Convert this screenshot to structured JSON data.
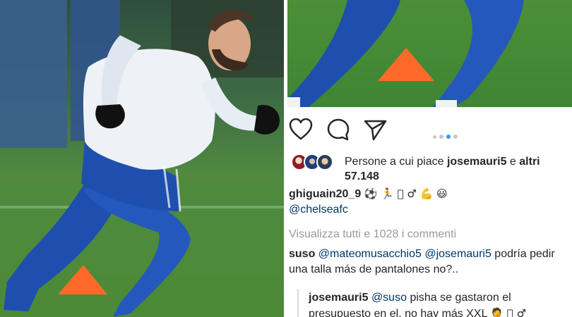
{
  "post": {
    "likes_prefix": "Persone a cui piace",
    "likes_user": "josemauri5",
    "likes_connector": "e",
    "likes_others_label": "altri",
    "likes_count": "57.148",
    "carousel": {
      "dots": 4,
      "active_index": 2
    }
  },
  "caption": {
    "username": "ghiguain20_9",
    "emojis": "⚽ 🏃 🏽 ♂ 💪 😃",
    "mention": "@chelseafc"
  },
  "comments": {
    "view_all": "Visualizza tutti e 1028 i commenti",
    "items": [
      {
        "username": "suso",
        "mention_1": "@mateomusacchio5",
        "mention_2": "@josemauri5",
        "text": "podría pedir una talla más de pantalones no?.."
      },
      {
        "username": "josemauri5",
        "mention": "@suso",
        "text": "pisha se gastaron el presupuesto en el, no hay más XXL",
        "emojis": "🤦 🏼 ♂"
      }
    ]
  },
  "icons": {
    "like": "heart-icon",
    "comment": "comment-bubble-icon",
    "share": "paper-plane-icon"
  },
  "colors": {
    "link": "#003569",
    "muted": "#999999",
    "carousel_active": "#3897f0",
    "jersey_blue": "#1f4fae",
    "cone_orange": "#ff6a2a"
  }
}
